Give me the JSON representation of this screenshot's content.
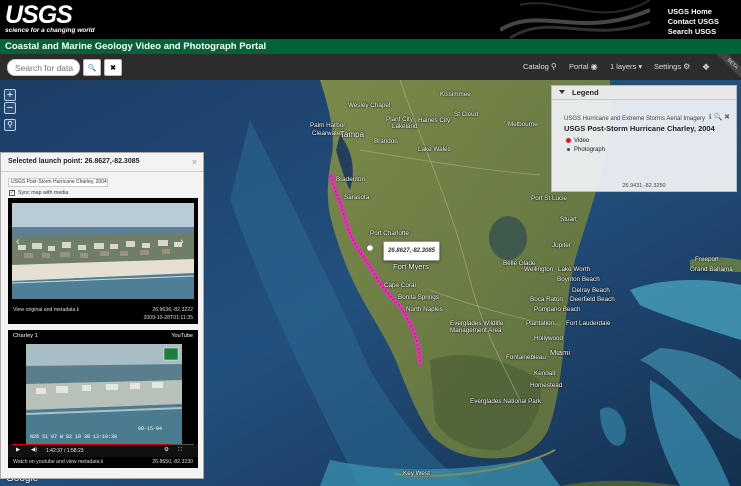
{
  "header": {
    "logo": "USGS",
    "tagline": "science for a changing world",
    "links": [
      "USGS Home",
      "Contact USGS",
      "Search USGS"
    ],
    "portal_title": "Coastal and Marine Geology Video and Photograph Portal"
  },
  "toolbar": {
    "search_placeholder": "Search for data",
    "search_icon": "🔍",
    "clear_icon": "✖",
    "catalog": "Catalog",
    "portal": "Portal",
    "layers": "1 layers ▾",
    "settings": "Settings",
    "beta": "BETA"
  },
  "map": {
    "zoom_in": "+",
    "zoom_out": "−",
    "popup_coord": "26.8627,-82.3085",
    "attribution": "Google",
    "cities": [
      {
        "name": "Kissimmee"
      },
      {
        "name": "Wesley Chapel"
      },
      {
        "name": "Plant City"
      },
      {
        "name": "Palm Harbor"
      },
      {
        "name": "Tampa"
      },
      {
        "name": "Lakeland"
      },
      {
        "name": "Clearwater"
      },
      {
        "name": "Haines City"
      },
      {
        "name": "Melbourne"
      },
      {
        "name": "Brandon"
      },
      {
        "name": "St Cloud"
      },
      {
        "name": "Lake Wales"
      },
      {
        "name": "Bradenton"
      },
      {
        "name": "Sarasota"
      },
      {
        "name": "Port Charlotte"
      },
      {
        "name": "Fort Myers"
      },
      {
        "name": "Cape Coral"
      },
      {
        "name": "Bonita Springs"
      },
      {
        "name": "North Naples"
      },
      {
        "name": "Port St Lucie"
      },
      {
        "name": "Stuart"
      },
      {
        "name": "Jupiter"
      },
      {
        "name": "Belle Glade"
      },
      {
        "name": "Wellington"
      },
      {
        "name": "Lake Worth"
      },
      {
        "name": "Boynton Beach"
      },
      {
        "name": "Delray Beach"
      },
      {
        "name": "Boca Raton"
      },
      {
        "name": "Deerfield Beach"
      },
      {
        "name": "Pompano Beach"
      },
      {
        "name": "Plantation"
      },
      {
        "name": "Fort Lauderdale"
      },
      {
        "name": "Hollywood"
      },
      {
        "name": "Everglades Wildlife Management Area"
      },
      {
        "name": "Fontainebleau"
      },
      {
        "name": "Miami"
      },
      {
        "name": "Kendall"
      },
      {
        "name": "Homestead"
      },
      {
        "name": "Everglades National Park"
      },
      {
        "name": "Key West"
      },
      {
        "name": "Grand Bahama"
      },
      {
        "name": "Freeport"
      }
    ]
  },
  "legend": {
    "heading": "Legend",
    "subtitle": "USGS Hurricane and Extreme Storms Aerial Imagery",
    "title": "USGS Post-Storm Hurricane Charley, 2004",
    "icons": "ℹ 🔍 ✖",
    "items": [
      {
        "label": "Video",
        "color": "#e0141e"
      },
      {
        "label": "Photograph",
        "color": "#2233dd"
      }
    ],
    "coord": "26.9431,-82.3250"
  },
  "panel": {
    "title": "Selected launch point: 26.8627,-82.3085",
    "close": "×",
    "series": "USGS Post-Storm Hurricane Charley, 2004",
    "sync_label": "Sync map with media",
    "photo": {
      "link": "View original and metadata ℹ",
      "coord": "26.9636,-82.3222",
      "timestamp": "2009-10-28T01:11:35",
      "prev": "‹",
      "next": "›"
    },
    "video": {
      "title": "Charley 1",
      "source": "YouTube",
      "time": "1:42:37 / 1:58:23",
      "link": "Watch on youtube and view metadata ℹ",
      "coord": "26.8650,-82.3230",
      "play": "▶",
      "volume": "◀)",
      "settings_icon": "⚙",
      "fullscreen_icon": "⛶",
      "hud_date": "08-15-04",
      "hud_coords": "N26 51 07  W 82 19 30  13:10:38"
    }
  }
}
